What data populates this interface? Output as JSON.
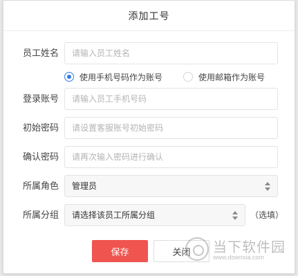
{
  "dialog": {
    "title": "添加工号"
  },
  "form": {
    "name": {
      "label": "员工姓名",
      "placeholder": "请输入员工姓名",
      "value": ""
    },
    "account_type": {
      "options": [
        {
          "label": "使用手机号码作为账号",
          "checked": true
        },
        {
          "label": "使用邮箱作为账号",
          "checked": false
        }
      ]
    },
    "login": {
      "label": "登录账号",
      "placeholder": "请输入员工手机号码",
      "value": ""
    },
    "init_password": {
      "label": "初始密码",
      "placeholder": "请设置客服账号初始密码",
      "value": ""
    },
    "confirm_password": {
      "label": "确认密码",
      "placeholder": "请再次输入密码进行确认",
      "value": ""
    },
    "role": {
      "label": "所属角色",
      "selected": "管理员"
    },
    "group": {
      "label": "所属分组",
      "selected": "请选择该员工所属分组",
      "optional_note": "（选填）"
    }
  },
  "buttons": {
    "save": "保存",
    "close": "关闭"
  },
  "watermark": {
    "title": "当下软件园",
    "url": "www.downxia.com"
  },
  "colors": {
    "primary": "#f0544f",
    "radio_accent": "#2f7de1"
  }
}
